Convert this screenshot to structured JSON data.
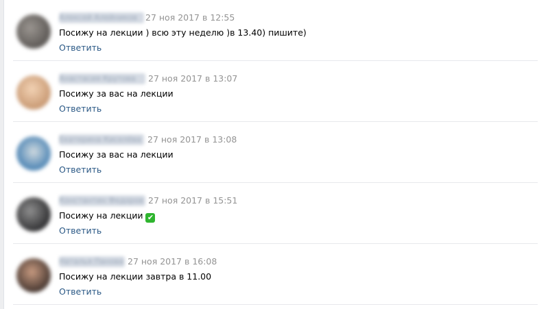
{
  "comments": [
    {
      "author": "Алексей Алейников",
      "date": "27 ноя 2017 в 12:55",
      "text": "Посижу на лекции ) всю эту неделю )в 13.40) пишите)",
      "reply_label": "Ответить",
      "avatar_color": "#7c7570"
    },
    {
      "author": "Анастасия Крутова",
      "date": "27 ноя 2017 в 13:07",
      "text": "Посижу за вас на лекции",
      "reply_label": "Ответить",
      "avatar_color": "#d9b497"
    },
    {
      "author": "Екатерина Киселёва",
      "date": "27 ноя 2017 в 13:08",
      "text": "Посижу за вас на лекции",
      "reply_label": "Ответить",
      "avatar_color": "#6d93b3"
    },
    {
      "author": "Константин Федоров",
      "date": "27 ноя 2017 в 15:51",
      "text": "Посижу на лекции",
      "reply_label": "Ответить",
      "avatar_color": "#4c4c4e",
      "emoji": "✔"
    },
    {
      "author": "Наталья Панова",
      "date": "27 ноя 2017 в 16:08",
      "text": "Посижу на лекции завтра в 11.00",
      "reply_label": "Ответить",
      "avatar_color": "#8a6d5f"
    }
  ]
}
